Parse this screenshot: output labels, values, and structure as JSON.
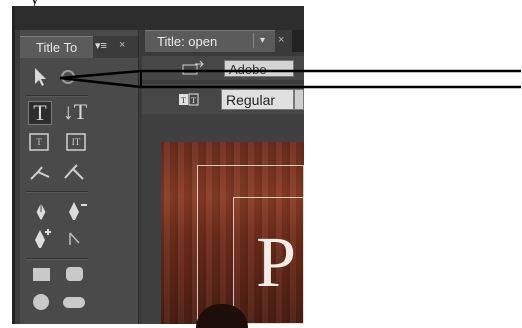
{
  "above_text": "y",
  "tools_panel": {
    "tab_title": "Title To",
    "menu_glyph": "▾≡",
    "close_glyph": "×",
    "tools": {
      "selection": "selection-arrow-icon",
      "rotation": "rotation-icon",
      "type_horizontal": "T",
      "type_vertical": "↓T",
      "area_type": "area-type-icon",
      "vertical_area_type": "vertical-area-type-icon",
      "path_type": "path-type-icon",
      "vertical_path_type": "vertical-path-type-icon",
      "pen": "pen-icon",
      "delete_anchor": "delete-anchor-icon",
      "add_anchor": "add-anchor-icon",
      "convert_anchor": "convert-anchor-icon",
      "rectangle": "rectangle-icon",
      "rounded_rectangle": "rounded-rectangle-icon",
      "ellipse": "ellipse-icon",
      "rounded_pill": "pill-icon"
    }
  },
  "title_panel": {
    "tab_title": "Title: open",
    "drop_glyph": "▾",
    "close_glyph": "×",
    "font_family_value": "Adobe",
    "font_style_value": "Regular",
    "preview_text": "P"
  },
  "colors": {
    "panel_bg": "#4a4a4a",
    "arrow": "#000000",
    "preview_wood": "#7a3420"
  }
}
